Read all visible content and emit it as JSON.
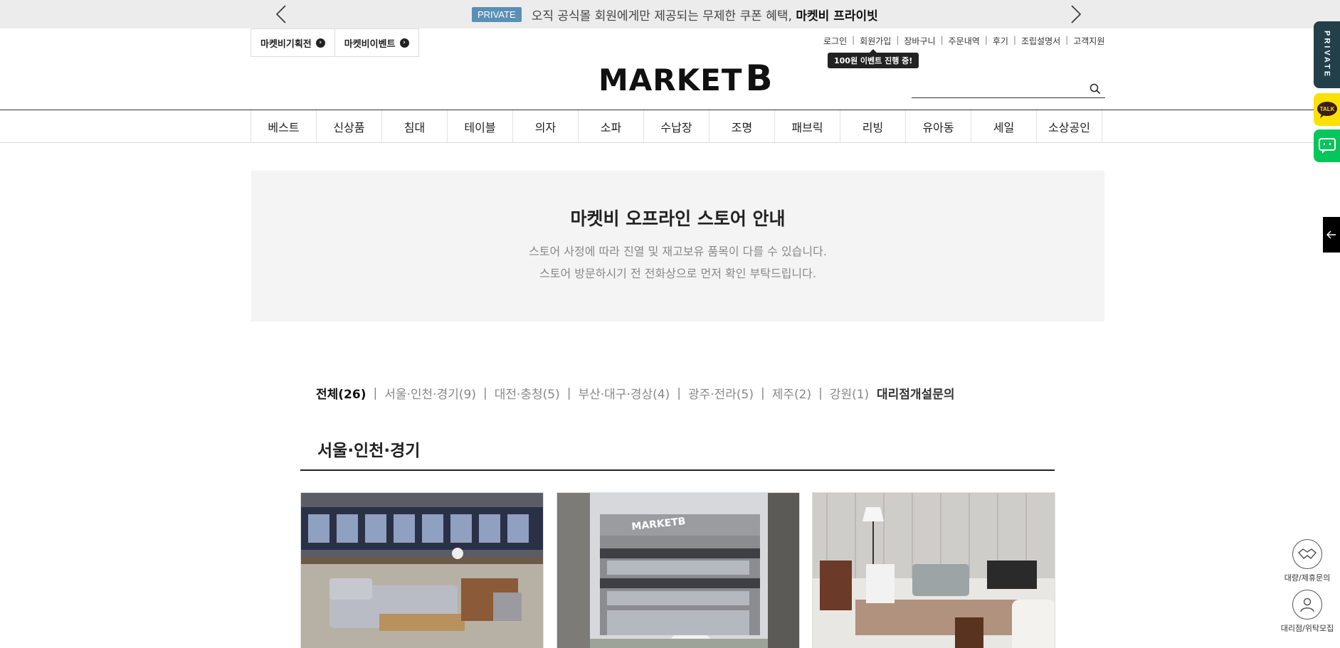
{
  "promo": {
    "badge": "PRIVATE",
    "message": "오직 공식몰 회원에게만 제공되는 무제한 쿠폰 혜택,",
    "message_bold": "마켓비 프라이빗"
  },
  "quick_links": [
    {
      "label": "마켓비기획전"
    },
    {
      "label": "마켓비이벤트"
    }
  ],
  "util_links": [
    "로그인",
    "회원가입",
    "장바구니",
    "주문내역",
    "후기",
    "조립설명서",
    "고객지원"
  ],
  "tooltip": "100원 이벤트 진행 중!",
  "logo": {
    "main": "MARKET",
    "letter": "B"
  },
  "search": {
    "placeholder": ""
  },
  "nav": [
    "베스트",
    "신상품",
    "침대",
    "테이블",
    "의자",
    "소파",
    "수납장",
    "조명",
    "패브릭",
    "리빙",
    "유아동",
    "세일",
    "소상공인"
  ],
  "info": {
    "title": "마켓비 오프라인 스토어 안내",
    "line1": "스토어 사정에 따라 진열 및 재고보유 품목이 다를 수 있습니다.",
    "line2": "스토어 방문하시기 전 전화상으로 먼저 확인 부탁드립니다."
  },
  "regions": [
    "전체(26)",
    "서울·인천·경기(9)",
    "대전·충청(5)",
    "부산·대구·경상(4)",
    "광주·전라(5)",
    "제주(2)",
    "강원(1)"
  ],
  "inquiry": "대리점개설문의",
  "section_title": "서울·인천·경기",
  "cards": [
    {
      "image": "store-interior-cafe"
    },
    {
      "image": "store-building-marketb"
    },
    {
      "image": "store-showroom-sofa"
    }
  ],
  "side": {
    "private": "PRIVATE",
    "talk": "TALK",
    "partner": "대량/제휴문의",
    "agency": "대리점/위탁모집"
  },
  "colors": {
    "badge": "#5a8fb6",
    "private_tab": "#23404a",
    "kakao": "#fae100",
    "naver": "#03c75a"
  }
}
